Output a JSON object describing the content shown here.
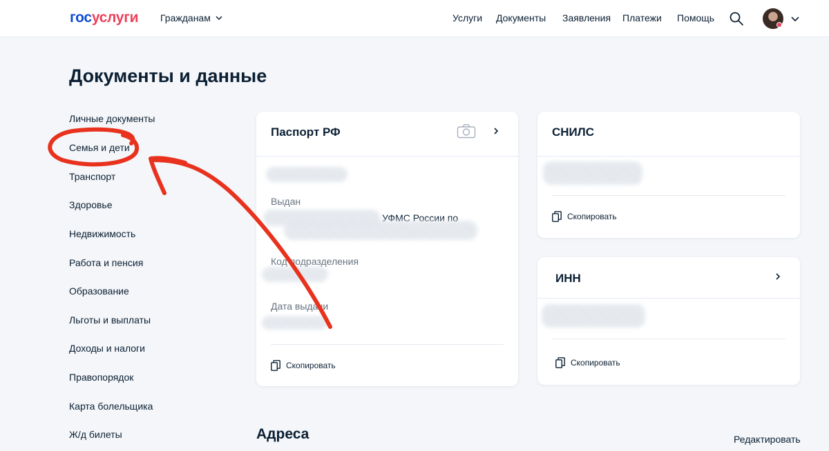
{
  "header": {
    "logo_part1": "гос",
    "logo_part2": "услуги",
    "citizens_label": "Гражданам",
    "nav": [
      "Услуги",
      "Документы",
      "Заявления",
      "Платежи",
      "Помощь"
    ]
  },
  "page_title": "Документы и данные",
  "sidebar": {
    "items": [
      "Личные документы",
      "Семья и дети",
      "Транспорт",
      "Здоровье",
      "Недвижимость",
      "Работа и пенсия",
      "Образование",
      "Льготы и выплаты",
      "Доходы и налоги",
      "Правопорядок",
      "Карта болельщика",
      "Ж/д билеты"
    ]
  },
  "passport_card": {
    "title": "Паспорт РФ",
    "issued_label": "Выдан",
    "issued_value_partial": "УФМС России по",
    "dept_code_label": "Код подразделения",
    "issue_date_label": "Дата выдачи",
    "copy_label": "Скопировать"
  },
  "snils_card": {
    "title": "СНИЛС",
    "copy_label": "Скопировать"
  },
  "inn_card": {
    "title": "ИНН",
    "copy_label": "Скопировать"
  },
  "addresses": {
    "title": "Адреса",
    "edit_label": "Редактировать"
  },
  "colors": {
    "brand_blue": "#0d4cd3",
    "brand_red": "#ee3f58",
    "annotation_red": "#e8321e"
  },
  "icons": [
    "chevron-down-icon",
    "search-icon",
    "camera-icon",
    "chevron-right-icon",
    "copy-icon"
  ]
}
